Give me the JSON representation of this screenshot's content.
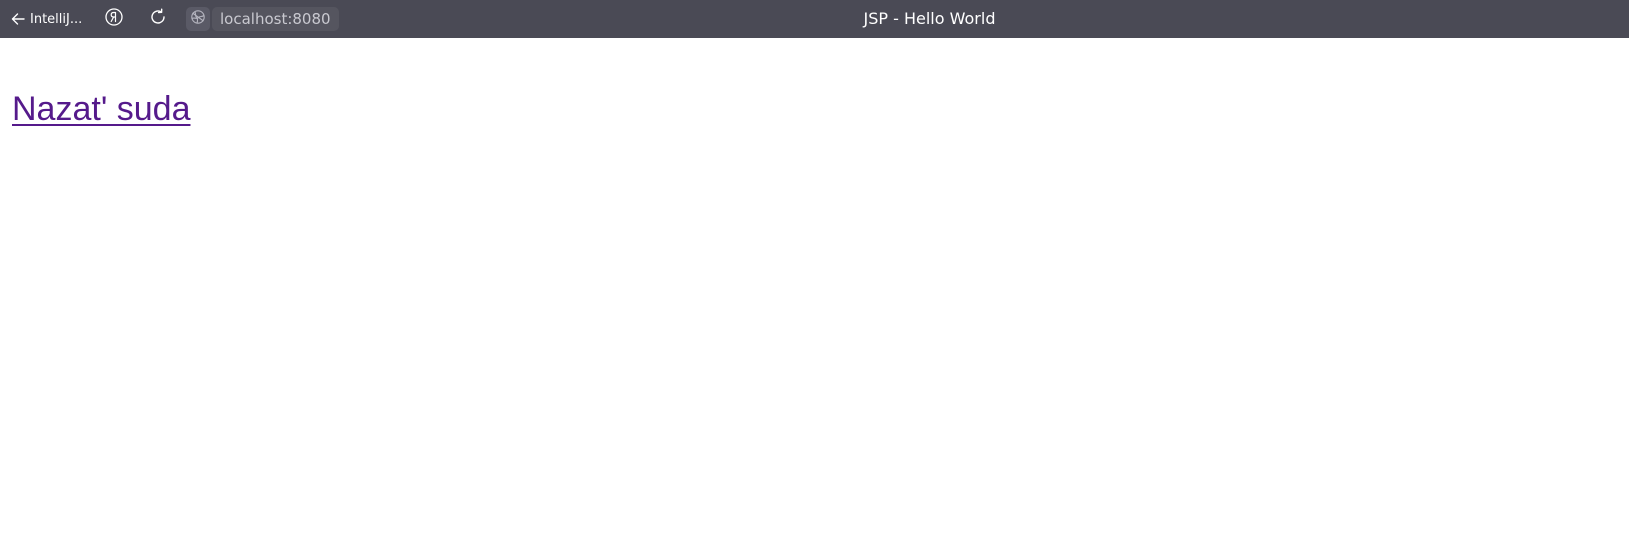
{
  "browser": {
    "back_label": "IntelliJ...",
    "address": "localhost:8080",
    "title": "JSP - Hello World",
    "colors": {
      "toolbar_bg": "#4a4a55",
      "link_visited": "#551a8b"
    },
    "icons": [
      "arrow-left-icon",
      "yandex-icon",
      "reload-icon",
      "globe-icon"
    ]
  },
  "page": {
    "link_text": "Nazat' suda"
  }
}
